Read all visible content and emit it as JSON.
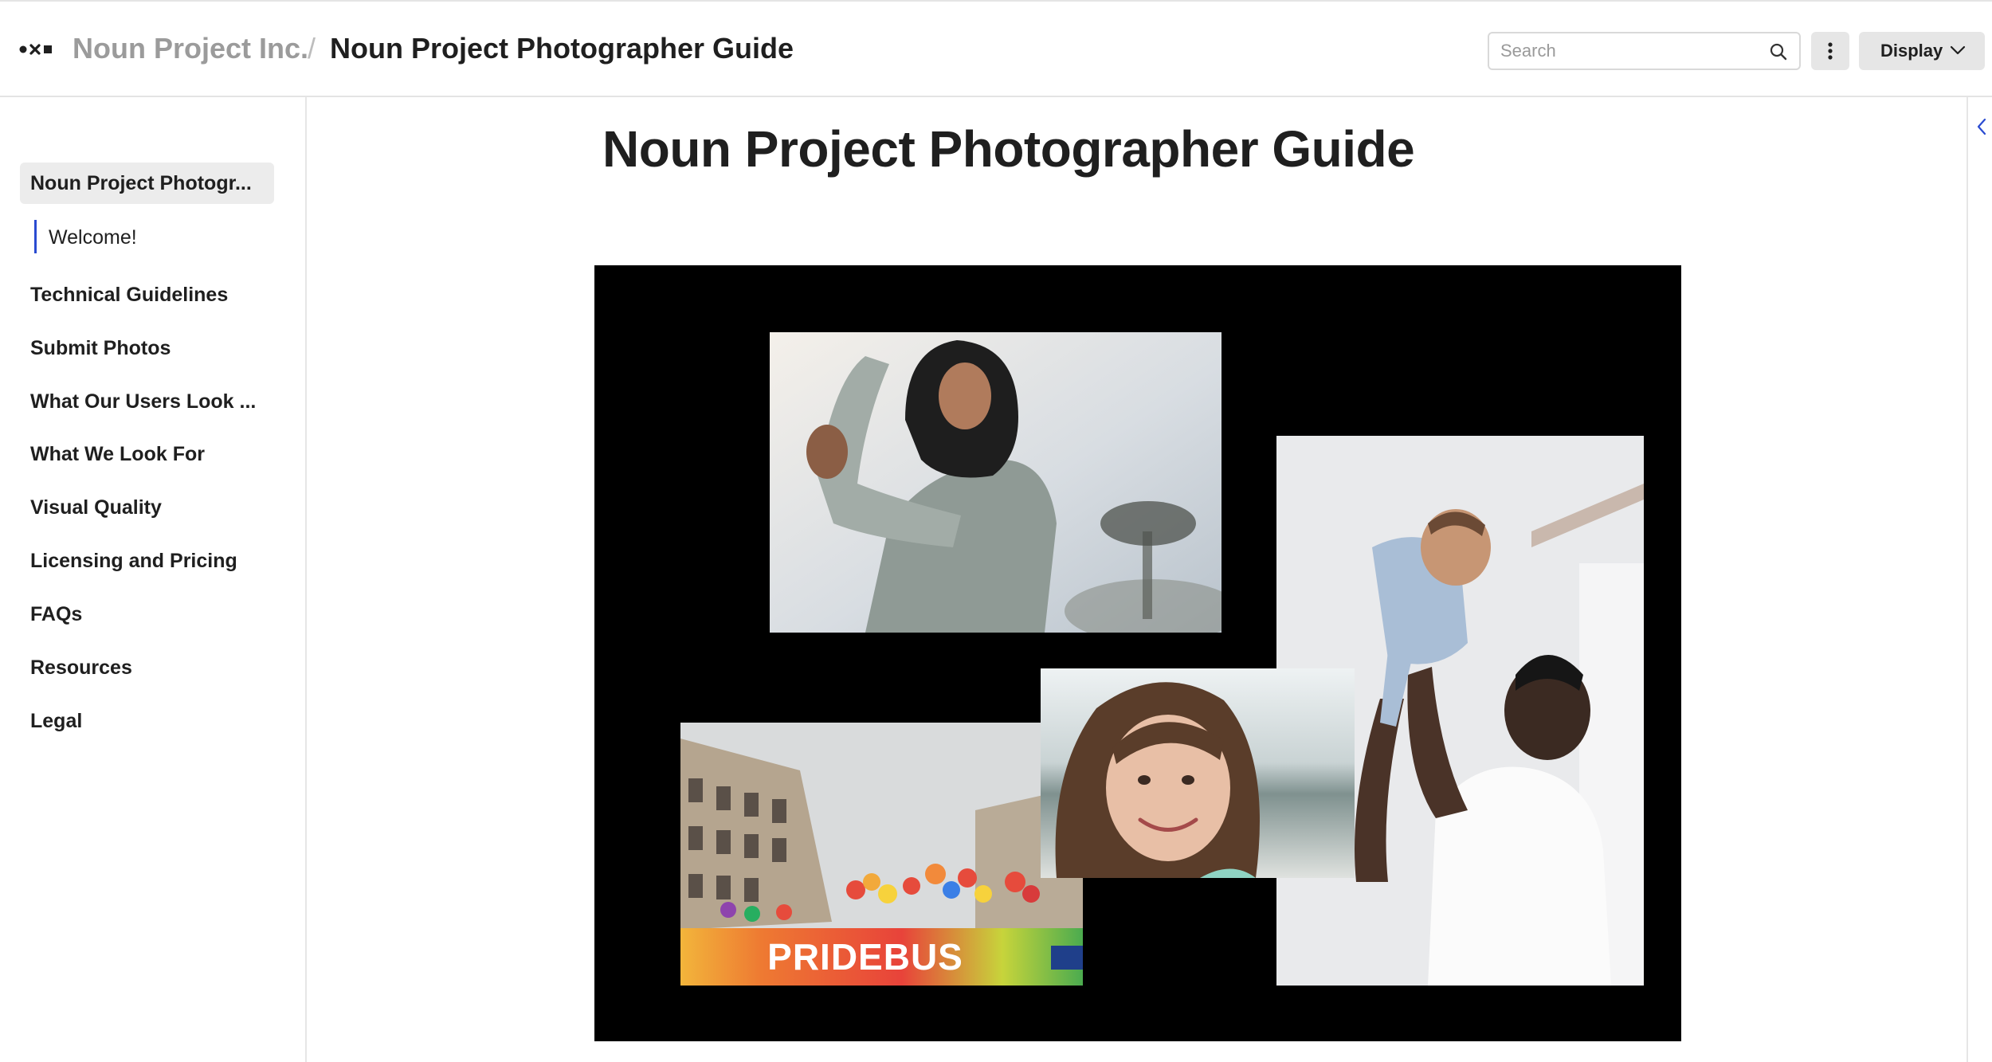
{
  "header": {
    "org": "Noun Project Inc.",
    "separator": "/",
    "page": "Noun Project Photographer Guide",
    "search_placeholder": "Search",
    "display_label": "Display"
  },
  "sidebar": {
    "active": "Noun Project Photogr...",
    "sub": "Welcome!",
    "items": [
      "Technical Guidelines",
      "Submit Photos",
      "What Our Users Look ...",
      "What We Look For",
      "Visual Quality",
      "Licensing and Pricing",
      "FAQs",
      "Resources",
      "Legal"
    ]
  },
  "main": {
    "title": "Noun Project Photographer Guide",
    "bus_sign": "PRIDEBUS"
  },
  "colors": {
    "accent": "#2a4bd1",
    "hero_bg": "#000000"
  }
}
